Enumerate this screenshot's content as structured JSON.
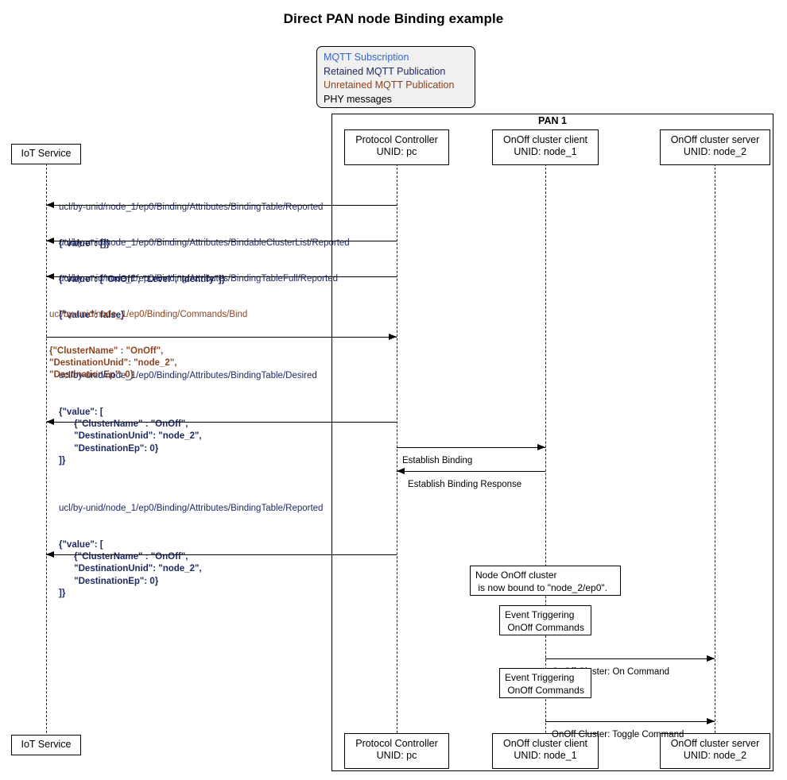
{
  "title": "Direct PAN node Binding example",
  "legend": {
    "name": "message-type-legend",
    "items": [
      {
        "label": "MQTT Subscription",
        "color": "#3366CC",
        "kind": "subscription"
      },
      {
        "label": "Retained MQTT Publication",
        "color": "#1F2A63",
        "kind": "retained"
      },
      {
        "label": "Unretained MQTT Publication",
        "color": "#8C4420",
        "kind": "unretained"
      },
      {
        "label": "PHY messages",
        "color": "#000000",
        "kind": "phy"
      }
    ]
  },
  "frame": {
    "label": "PAN 1"
  },
  "participants": [
    {
      "id": "iot",
      "line1": "IoT Service",
      "line2": ""
    },
    {
      "id": "pc",
      "line1": "Protocol Controller",
      "line2": "UNID: pc"
    },
    {
      "id": "client",
      "line1": "OnOff cluster client",
      "line2": "UNID: node_1"
    },
    {
      "id": "server",
      "line1": "OnOff cluster server",
      "line2": "UNID: node_2"
    }
  ],
  "messages": [
    {
      "id": "m1",
      "kind": "retained",
      "from": "pc",
      "to": "iot",
      "direction": "left",
      "topic": "ucl/by-unid/node_1/ep0/Binding/Attributes/BindingTable/Reported",
      "payload": "{\"value\": []}"
    },
    {
      "id": "m2",
      "kind": "retained",
      "from": "pc",
      "to": "iot",
      "direction": "left",
      "topic": "ucl/by-unid/node_1/ep0/Binding/Attributes/BindableClusterList/Reported",
      "payload": "{\"value\": [\"OnOff\", \"Level\",\"Identify\"]}"
    },
    {
      "id": "m3",
      "kind": "retained",
      "from": "pc",
      "to": "iot",
      "direction": "left",
      "topic": "ucl/by-unid/node_1/ep0/Binding/Attributes/BindingTableFull/Reported",
      "payload": "{\"value\": false}"
    },
    {
      "id": "m4",
      "kind": "unretained",
      "from": "iot",
      "to": "pc",
      "direction": "right",
      "topic": "ucl/by-unid/node_1/ep0/Binding/Commands/Bind",
      "payload": "{\"ClusterName\" : \"OnOff\",\n\"DestinationUnid\": \"node_2\",\n\"DestinationEp\": 0}"
    },
    {
      "id": "m5",
      "kind": "retained",
      "from": "pc",
      "to": "iot",
      "direction": "left",
      "topic": "ucl/by-unid/node_1/ep0/Binding/Attributes/BindingTable/Desired",
      "payload": "{\"value\": [\n      {\"ClusterName\" : \"OnOff\",\n      \"DestinationUnid\": \"node_2\",\n      \"DestinationEp\": 0}\n]}"
    },
    {
      "id": "m6",
      "kind": "phy",
      "from": "pc",
      "to": "client",
      "direction": "right",
      "topic": "Establish Binding",
      "payload": ""
    },
    {
      "id": "m7",
      "kind": "phy",
      "from": "client",
      "to": "pc",
      "direction": "left",
      "topic": "Establish Binding Response",
      "payload": ""
    },
    {
      "id": "m8",
      "kind": "retained",
      "from": "pc",
      "to": "iot",
      "direction": "left",
      "topic": "ucl/by-unid/node_1/ep0/Binding/Attributes/BindingTable/Reported",
      "payload": "{\"value\": [\n      {\"ClusterName\" : \"OnOff\",\n      \"DestinationUnid\": \"node_2\",\n      \"DestinationEp\": 0}\n]}"
    },
    {
      "id": "m9",
      "kind": "phy",
      "from": "client",
      "to": "server",
      "direction": "right",
      "topic": "OnOff Cluster: On Command",
      "payload": ""
    },
    {
      "id": "m10",
      "kind": "phy",
      "from": "client",
      "to": "server",
      "direction": "right",
      "topic": "OnOff Cluster: Toggle Command",
      "payload": ""
    }
  ],
  "notes": [
    {
      "id": "n1",
      "text": "Node OnOff cluster\n is now bound to \"node_2/ep0\"."
    },
    {
      "id": "n2",
      "text": "Event Triggering\n OnOff Commands"
    },
    {
      "id": "n3",
      "text": "Event Triggering\n OnOff Commands"
    }
  ]
}
